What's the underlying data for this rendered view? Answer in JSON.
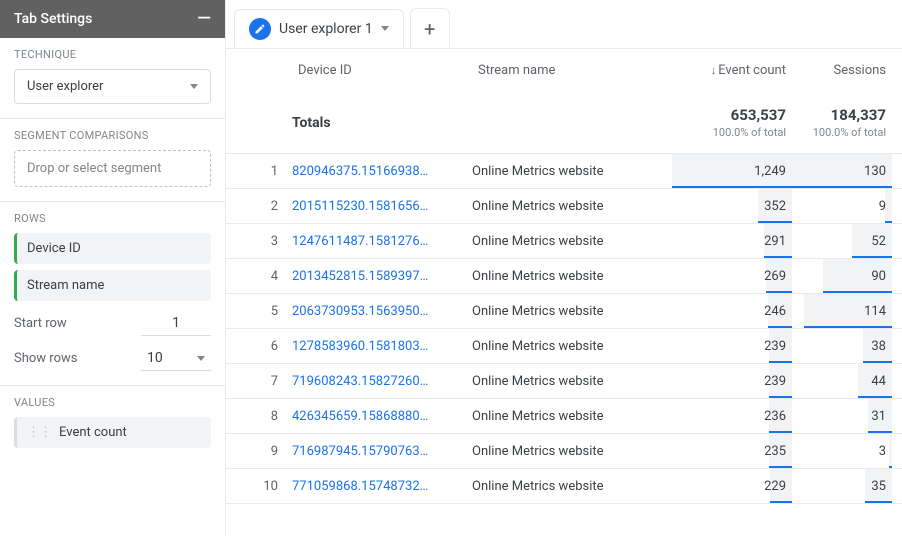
{
  "sidebar": {
    "title": "Tab Settings",
    "technique_label": "TECHNIQUE",
    "technique_value": "User explorer",
    "segment_label": "SEGMENT COMPARISONS",
    "segment_placeholder": "Drop or select segment",
    "rows_label": "ROWS",
    "row_chips": [
      "Device ID",
      "Stream name"
    ],
    "start_row_label": "Start row",
    "start_row_value": "1",
    "show_rows_label": "Show rows",
    "show_rows_value": "10",
    "values_label": "VALUES",
    "value_chips": [
      "Event count"
    ]
  },
  "tab": {
    "label": "User explorer 1"
  },
  "columns": {
    "device": "Device ID",
    "stream": "Stream name",
    "events": "Event count",
    "sessions": "Sessions"
  },
  "totals": {
    "label": "Totals",
    "events": "653,537",
    "events_sub": "100.0% of total",
    "sessions": "184,337",
    "sessions_sub": "100.0% of total"
  },
  "rows": [
    {
      "idx": "1",
      "device": "820946375.15166938…",
      "stream": "Online Metrics website",
      "events": "1,249",
      "sessions": "130",
      "ebar": 100,
      "sbar": 100,
      "efill": 100,
      "sfill": 100
    },
    {
      "idx": "2",
      "device": "2015115230.1581656…",
      "stream": "Online Metrics website",
      "events": "352",
      "sessions": "9",
      "ebar": 28,
      "sbar": 7,
      "efill": 28,
      "sfill": 7
    },
    {
      "idx": "3",
      "device": "1247611487.1581276…",
      "stream": "Online Metrics website",
      "events": "291",
      "sessions": "52",
      "ebar": 23,
      "sbar": 40,
      "efill": 23,
      "sfill": 40
    },
    {
      "idx": "4",
      "device": "2013452815.1589397…",
      "stream": "Online Metrics website",
      "events": "269",
      "sessions": "90",
      "ebar": 22,
      "sbar": 69,
      "efill": 22,
      "sfill": 69
    },
    {
      "idx": "5",
      "device": "2063730953.1563950…",
      "stream": "Online Metrics website",
      "events": "246",
      "sessions": "114",
      "ebar": 20,
      "sbar": 88,
      "efill": 20,
      "sfill": 88
    },
    {
      "idx": "6",
      "device": "1278583960.1581803…",
      "stream": "Online Metrics website",
      "events": "239",
      "sessions": "38",
      "ebar": 19,
      "sbar": 29,
      "efill": 19,
      "sfill": 29
    },
    {
      "idx": "7",
      "device": "719608243.15827260…",
      "stream": "Online Metrics website",
      "events": "239",
      "sessions": "44",
      "ebar": 19,
      "sbar": 34,
      "efill": 19,
      "sfill": 34
    },
    {
      "idx": "8",
      "device": "426345659.15868880…",
      "stream": "Online Metrics website",
      "events": "236",
      "sessions": "31",
      "ebar": 19,
      "sbar": 24,
      "efill": 19,
      "sfill": 24
    },
    {
      "idx": "9",
      "device": "716987945.15790763…",
      "stream": "Online Metrics website",
      "events": "235",
      "sessions": "3",
      "ebar": 19,
      "sbar": 3,
      "efill": 19,
      "sfill": 3
    },
    {
      "idx": "10",
      "device": "771059868.15748732…",
      "stream": "Online Metrics website",
      "events": "229",
      "sessions": "35",
      "ebar": 18,
      "sbar": 27,
      "efill": 18,
      "sfill": 27
    }
  ]
}
